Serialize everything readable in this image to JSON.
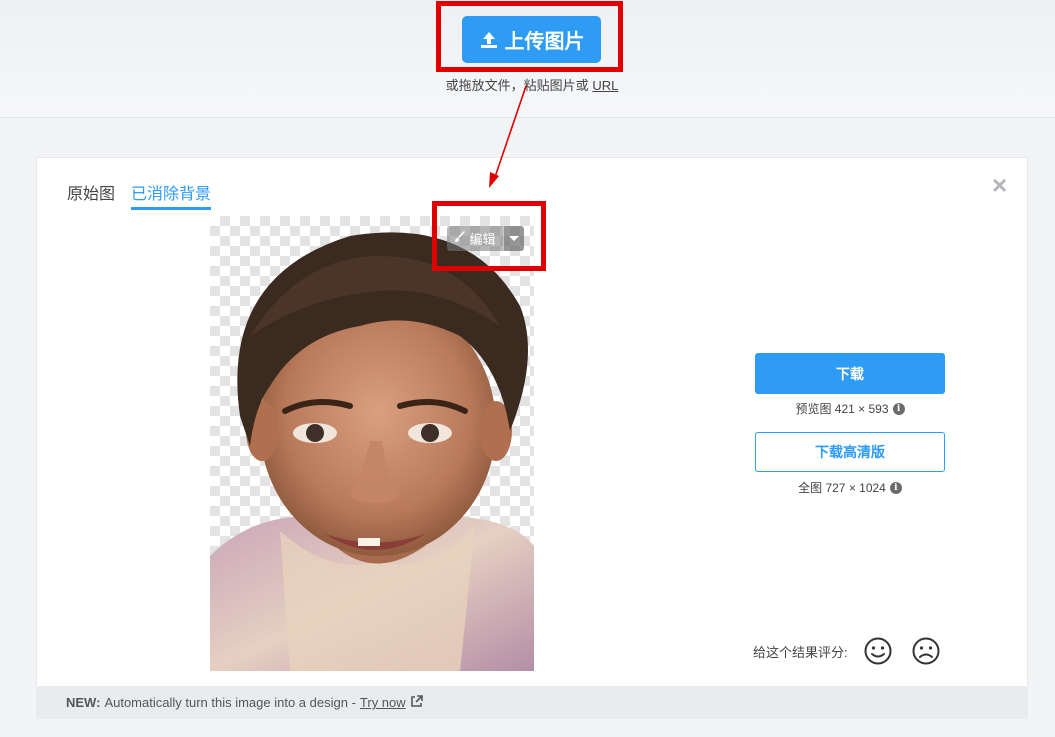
{
  "upload": {
    "button_label": "上传图片",
    "hint_text": "或拖放文件，粘贴图片或",
    "url_link": "URL"
  },
  "tabs": [
    {
      "label": "原始图",
      "active": false
    },
    {
      "label": "已消除背景",
      "active": true
    }
  ],
  "close_label": "×",
  "edit": {
    "label": "编辑"
  },
  "download": {
    "button_label": "下载",
    "preview_label": "预览图 421 × 593",
    "hd_button_label": "下载高清版",
    "full_label": "全图 727 × 1024"
  },
  "rating": {
    "label": "给这个结果评分:"
  },
  "footer": {
    "new_tag": "NEW:",
    "text": "Automatically turn this image into a design -",
    "link": "Try now"
  },
  "colors": {
    "accent": "#2e9bf5",
    "annotation_red": "#e00000"
  },
  "icons": [
    "upload-icon",
    "brush-icon",
    "caret-down-icon",
    "info-icon",
    "close-icon",
    "smile-icon",
    "frown-icon",
    "external-link-icon"
  ]
}
